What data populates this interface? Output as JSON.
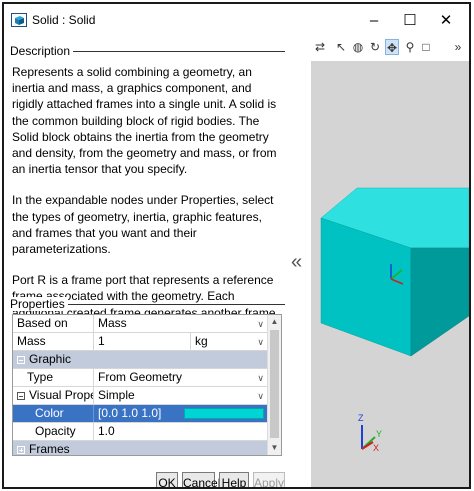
{
  "window": {
    "title": "Solid : Solid",
    "min_glyph": "–",
    "max_glyph": "☐",
    "close_glyph": "✕"
  },
  "description": {
    "label": "Description",
    "paragraphs": [
      "Represents a solid combining a geometry, an inertia and mass, a graphics component, and rigidly attached frames into a single unit. A solid is the common building block of rigid bodies. The Solid block obtains the inertia from the geometry and density, from the geometry and mass, or from an inertia tensor that you specify.",
      "In the expandable nodes under Properties, select the types of geometry, inertia, graphic features, and frames that you want and their parameterizations.",
      "Port R is a frame port that represents a reference frame associated with the geometry. Each additional created frame generates another frame port."
    ]
  },
  "properties": {
    "label": "Properties",
    "based_on": {
      "name": "Based on",
      "value": "Mass"
    },
    "mass": {
      "name": "Mass",
      "value": "1",
      "unit": "kg"
    },
    "graphic_group": "Graphic",
    "type": {
      "name": "Type",
      "value": "From Geometry"
    },
    "visual": {
      "name": "Visual Prope...",
      "value": "Simple"
    },
    "color": {
      "name": "Color",
      "value": "[0.0 1.0 1.0]",
      "swatch": "#00d4d4"
    },
    "opacity": {
      "name": "Opacity",
      "value": "1.0"
    },
    "frames_group": "Frames"
  },
  "buttons": {
    "ok": "OK",
    "cancel": "Cancel",
    "help": "Help",
    "apply": "Apply"
  },
  "viewer": {
    "collapse_glyph": "«",
    "more_glyph": "»",
    "axes": {
      "x": "X",
      "y": "Y",
      "z": "Z"
    },
    "colors": {
      "solid_front": "#00c2c2",
      "solid_top": "#2ee0e0",
      "solid_side": "#009a9a",
      "background": "#d4d4d4"
    }
  }
}
